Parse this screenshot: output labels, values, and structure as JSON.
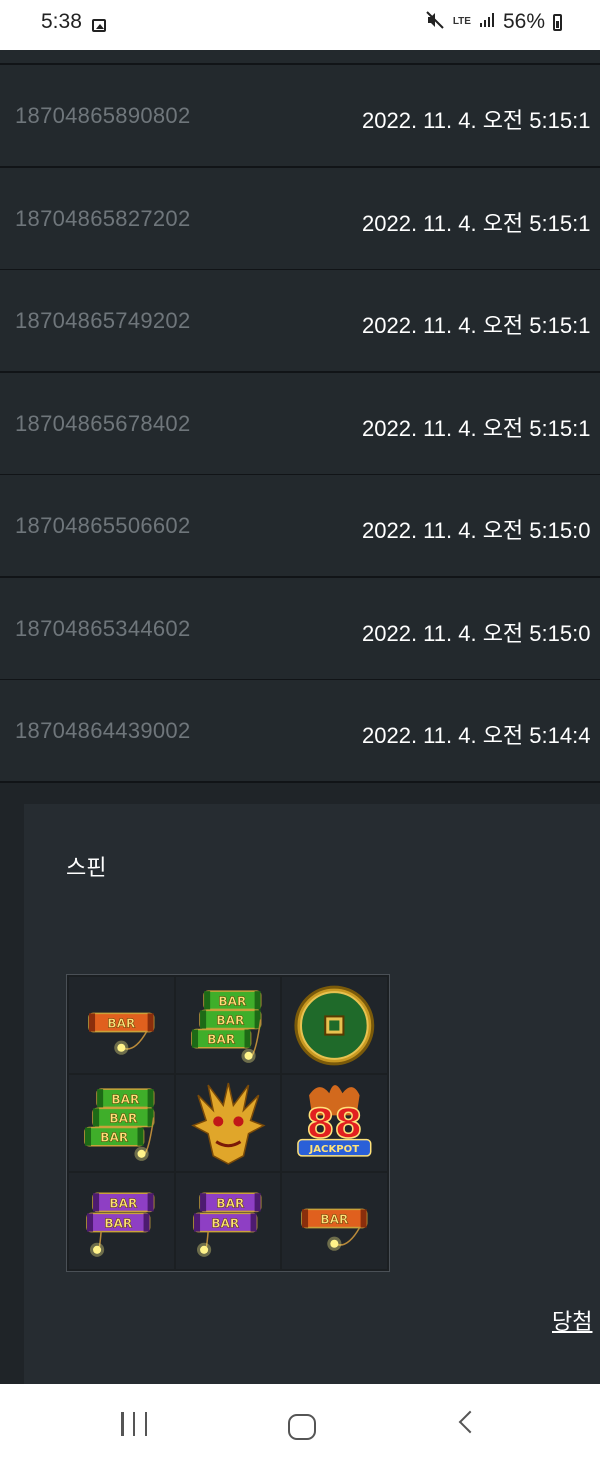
{
  "status_bar": {
    "time": "5:38",
    "network": "LTE",
    "battery": "56%"
  },
  "history": {
    "rows": [
      {
        "id": "18704865890802",
        "time": "2022. 11. 4. 오전 5:15:1"
      },
      {
        "id": "18704865827202",
        "time": "2022. 11. 4. 오전 5:15:1"
      },
      {
        "id": "18704865749202",
        "time": "2022. 11. 4. 오전 5:15:1"
      },
      {
        "id": "18704865678402",
        "time": "2022. 11. 4. 오전 5:15:1"
      },
      {
        "id": "18704865506602",
        "time": "2022. 11. 4. 오전 5:15:0"
      },
      {
        "id": "18704865344602",
        "time": "2022. 11. 4. 오전 5:15:0"
      },
      {
        "id": "18704864439002",
        "time": "2022. 11. 4. 오전 5:14:4"
      }
    ]
  },
  "detail": {
    "spin_label": "스핀",
    "win_label": "당첨",
    "grid": [
      [
        "bar-single-orange",
        "bar-triple-green",
        "gold-coin"
      ],
      [
        "bar-triple-green",
        "golden-dragon",
        "jackpot-88"
      ],
      [
        "bar-double-purple",
        "bar-double-purple",
        "bar-single-orange"
      ]
    ],
    "symbols": {
      "bar_text": "BAR",
      "jackpot_text": "JACKPOT",
      "jackpot_number": "88"
    }
  },
  "colors": {
    "row_bg": "#23292d",
    "panel_bg": "#262c31",
    "id_text": "#6f767b"
  }
}
